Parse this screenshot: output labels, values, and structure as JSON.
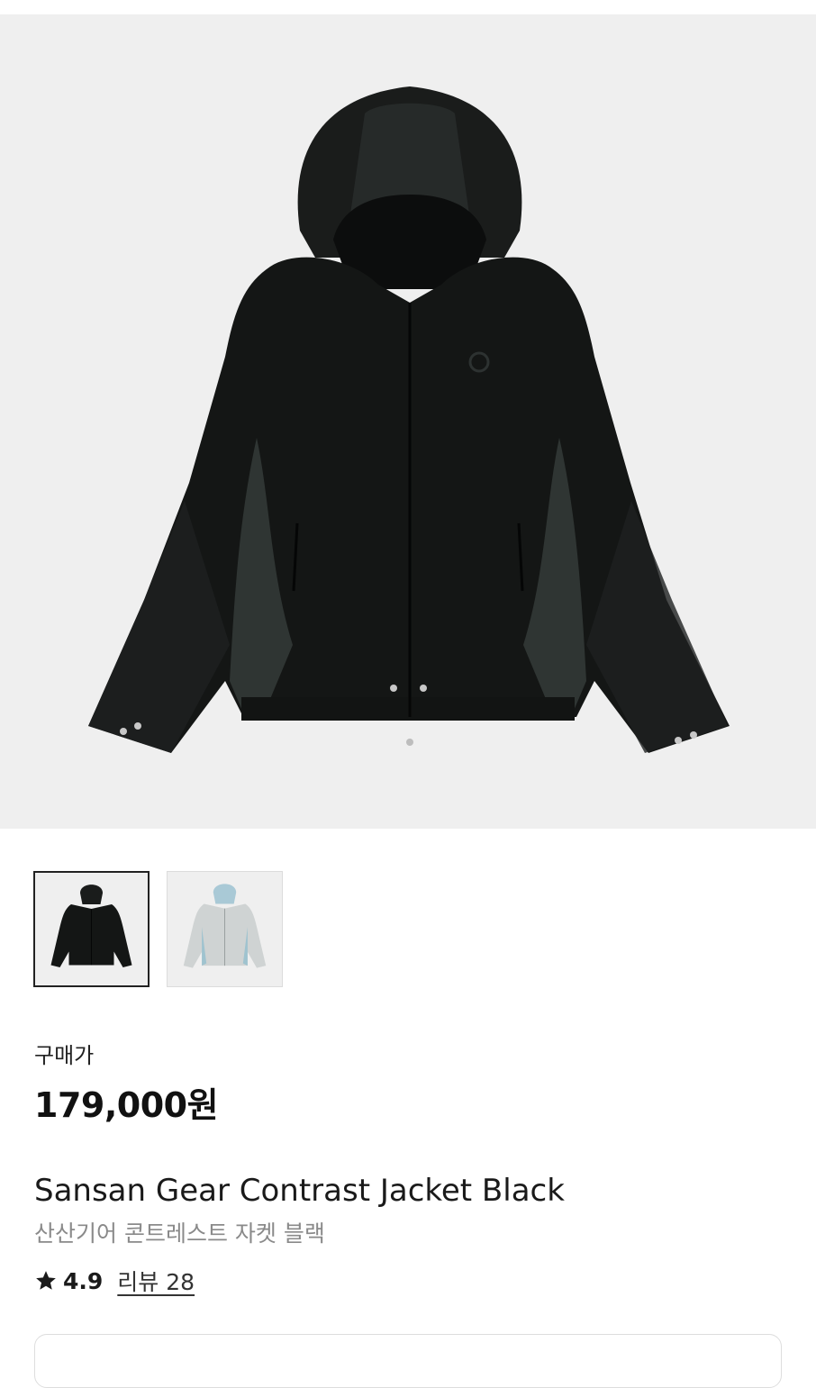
{
  "product": {
    "main_image_alt": "Sansan Gear Contrast Jacket Black",
    "thumbnails": [
      {
        "color": "black",
        "selected": true
      },
      {
        "color": "light-blue-grey",
        "selected": false
      }
    ],
    "price_label": "구매가",
    "price": "179,000원",
    "title_en": "Sansan Gear Contrast Jacket Black",
    "title_ko": "산산기어 콘트레스트 자켓 블랙",
    "rating": "4.9",
    "review_label": "리뷰 28"
  },
  "icons": {
    "rating": "star-icon"
  },
  "colors": {
    "image_bg": "#efefef",
    "jacket_black": "#141615",
    "jacket_panel": "#2f3533",
    "text_primary": "#222222",
    "text_secondary": "#8a8a8a"
  }
}
